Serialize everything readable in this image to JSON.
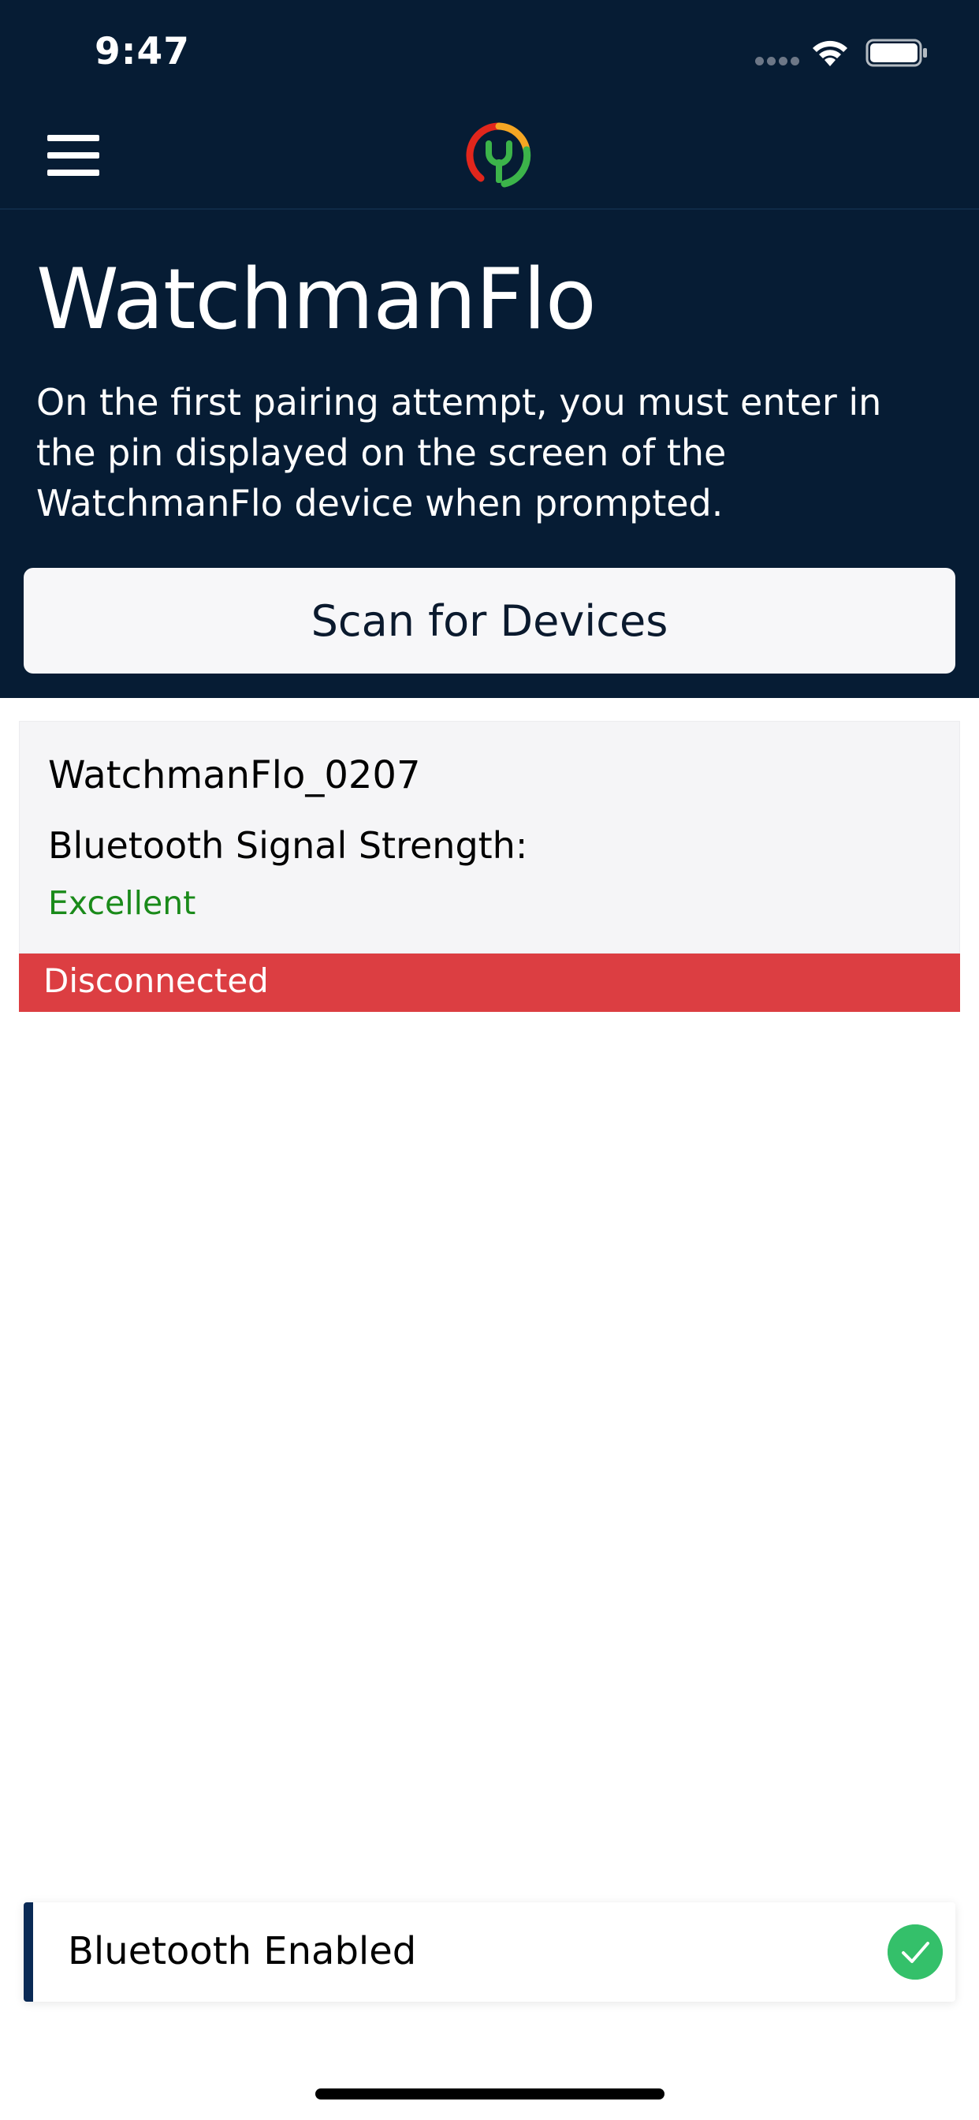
{
  "status_bar": {
    "time": "9:47"
  },
  "nav": {
    "menu_icon": "hamburger-icon",
    "logo_icon": "watchman-logo-icon"
  },
  "header": {
    "title": "WatchmanFlo",
    "subtitle": "On the first pairing attempt, you must enter in the pin displayed on the screen of the WatchmanFlo device when prompted.",
    "scan_button_label": "Scan for Devices"
  },
  "devices": [
    {
      "name": "WatchmanFlo_0207",
      "signal_label": "Bluetooth Signal Strength:",
      "signal_value": "Excellent",
      "status": "Disconnected"
    }
  ],
  "toast": {
    "message": "Bluetooth Enabled",
    "icon": "check-circle-icon"
  },
  "colors": {
    "header_bg": "#061c34",
    "signal_good": "#1a8a1a",
    "disconnected": "#dc3e42",
    "success": "#34c06a"
  }
}
